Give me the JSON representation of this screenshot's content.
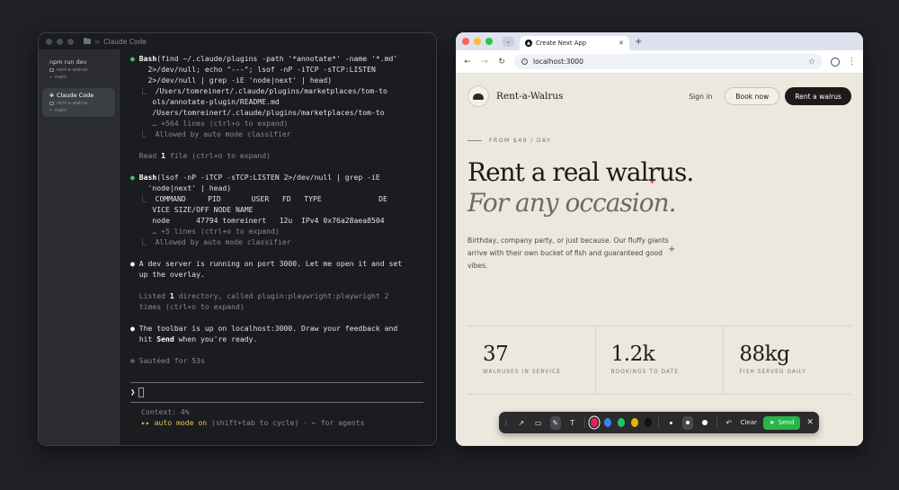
{
  "terminal": {
    "window_title": "Claude Code",
    "sessions": [
      {
        "title": "npm run dev",
        "folder": "rent-a-walrus",
        "branch": "main",
        "active": false
      },
      {
        "title": "Claude Code",
        "folder": "rent-a-walrus",
        "branch": "main",
        "active": true
      }
    ],
    "tool1_name": "Bash",
    "tool1_cmd_l1": "(find ~/.claude/plugins -path '*annotate*' -name '*.md'",
    "tool1_cmd_l2": "    2>/dev/null; echo \"---\"; lsof -nP -iTCP -sTCP:LISTEN",
    "tool1_cmd_l3": "    2>/dev/null | grep -iE 'node|next' | head)",
    "tool1_out": [
      "/Users/tomreinert/.claude/plugins/marketplaces/tom-to",
      "ols/annotate-plugin/README.md",
      "/Users/tomreinert/.claude/plugins/marketplaces/tom-to"
    ],
    "tool1_more": "… +564 lines (ctrl+o to expand)",
    "allowed_1": "Allowed by auto mode classifier",
    "read_line_pre": "Read ",
    "read_line_num": "1",
    "read_line_post": " file (ctrl+o to expand)",
    "tool2_name": "Bash",
    "tool2_cmd_l1": "(lsof -nP -iTCP -sTCP:LISTEN 2>/dev/null | grep -iE",
    "tool2_cmd_l2": "    'node|next' | head)",
    "tool2_out": [
      "COMMAND     PID       USER   FD   TYPE             DE",
      "VICE SIZE/OFF NODE NAME",
      "node      47794 tomreinert   12u  IPv4 0x76a28aea8504"
    ],
    "tool2_more": "… +5 lines (ctrl+o to expand)",
    "allowed_2": "Allowed by auto mode classifier",
    "msg1_l1": "A dev server is running on port 3000. Let me open it and set",
    "msg1_l2": "up the overlay.",
    "listed_l1_pre": "Listed ",
    "listed_l1_num": "1",
    "listed_l1_post": " directory, called plugin:playwright:playwright 2",
    "listed_l2": "times (ctrl+o to expand)",
    "msg2_l1": "The toolbar is up on localhost:3000. Draw your feedback and",
    "msg2_pre": "hit ",
    "msg2_send": "Send",
    "msg2_post": " when you're ready.",
    "sauteed": "✻ Sautéed for 53s",
    "prompt_char": "❯",
    "context": "Context: 4%",
    "auto_mode_arrows": "▸▸ auto mode on",
    "auto_mode_hint": " (shift+tab to cycle) · ← for agents"
  },
  "browser": {
    "tab_title": "Create Next App",
    "url": "localhost:3000",
    "site": {
      "brand": "Rent-a-Walrus",
      "nav_signin": "Sign in",
      "nav_book": "Book now",
      "nav_rent": "Rent a walrus",
      "eyebrow": "FROM $49 / DAY",
      "headline": "Rent a real walrus.",
      "headline_italic": "For any occasion.",
      "lede": "Birthday, company party, or just because. Our fluffy giants arrive with their own bucket of fish and guaranteed good vibes.",
      "stats": [
        {
          "value": "37",
          "label": "WALRUSES IN SERVICE"
        },
        {
          "value": "1.2k",
          "label": "BOOKINGS TO DATE"
        },
        {
          "value": "88kg",
          "label": "FISH SERVED DAILY"
        }
      ]
    },
    "annotation_toolbar": {
      "colors": [
        "#e0245e",
        "#3b82f6",
        "#22c55e",
        "#eab308",
        "#111111"
      ],
      "selected_color": "#e0245e",
      "clear_label": "Clear",
      "send_label": "Send"
    }
  }
}
